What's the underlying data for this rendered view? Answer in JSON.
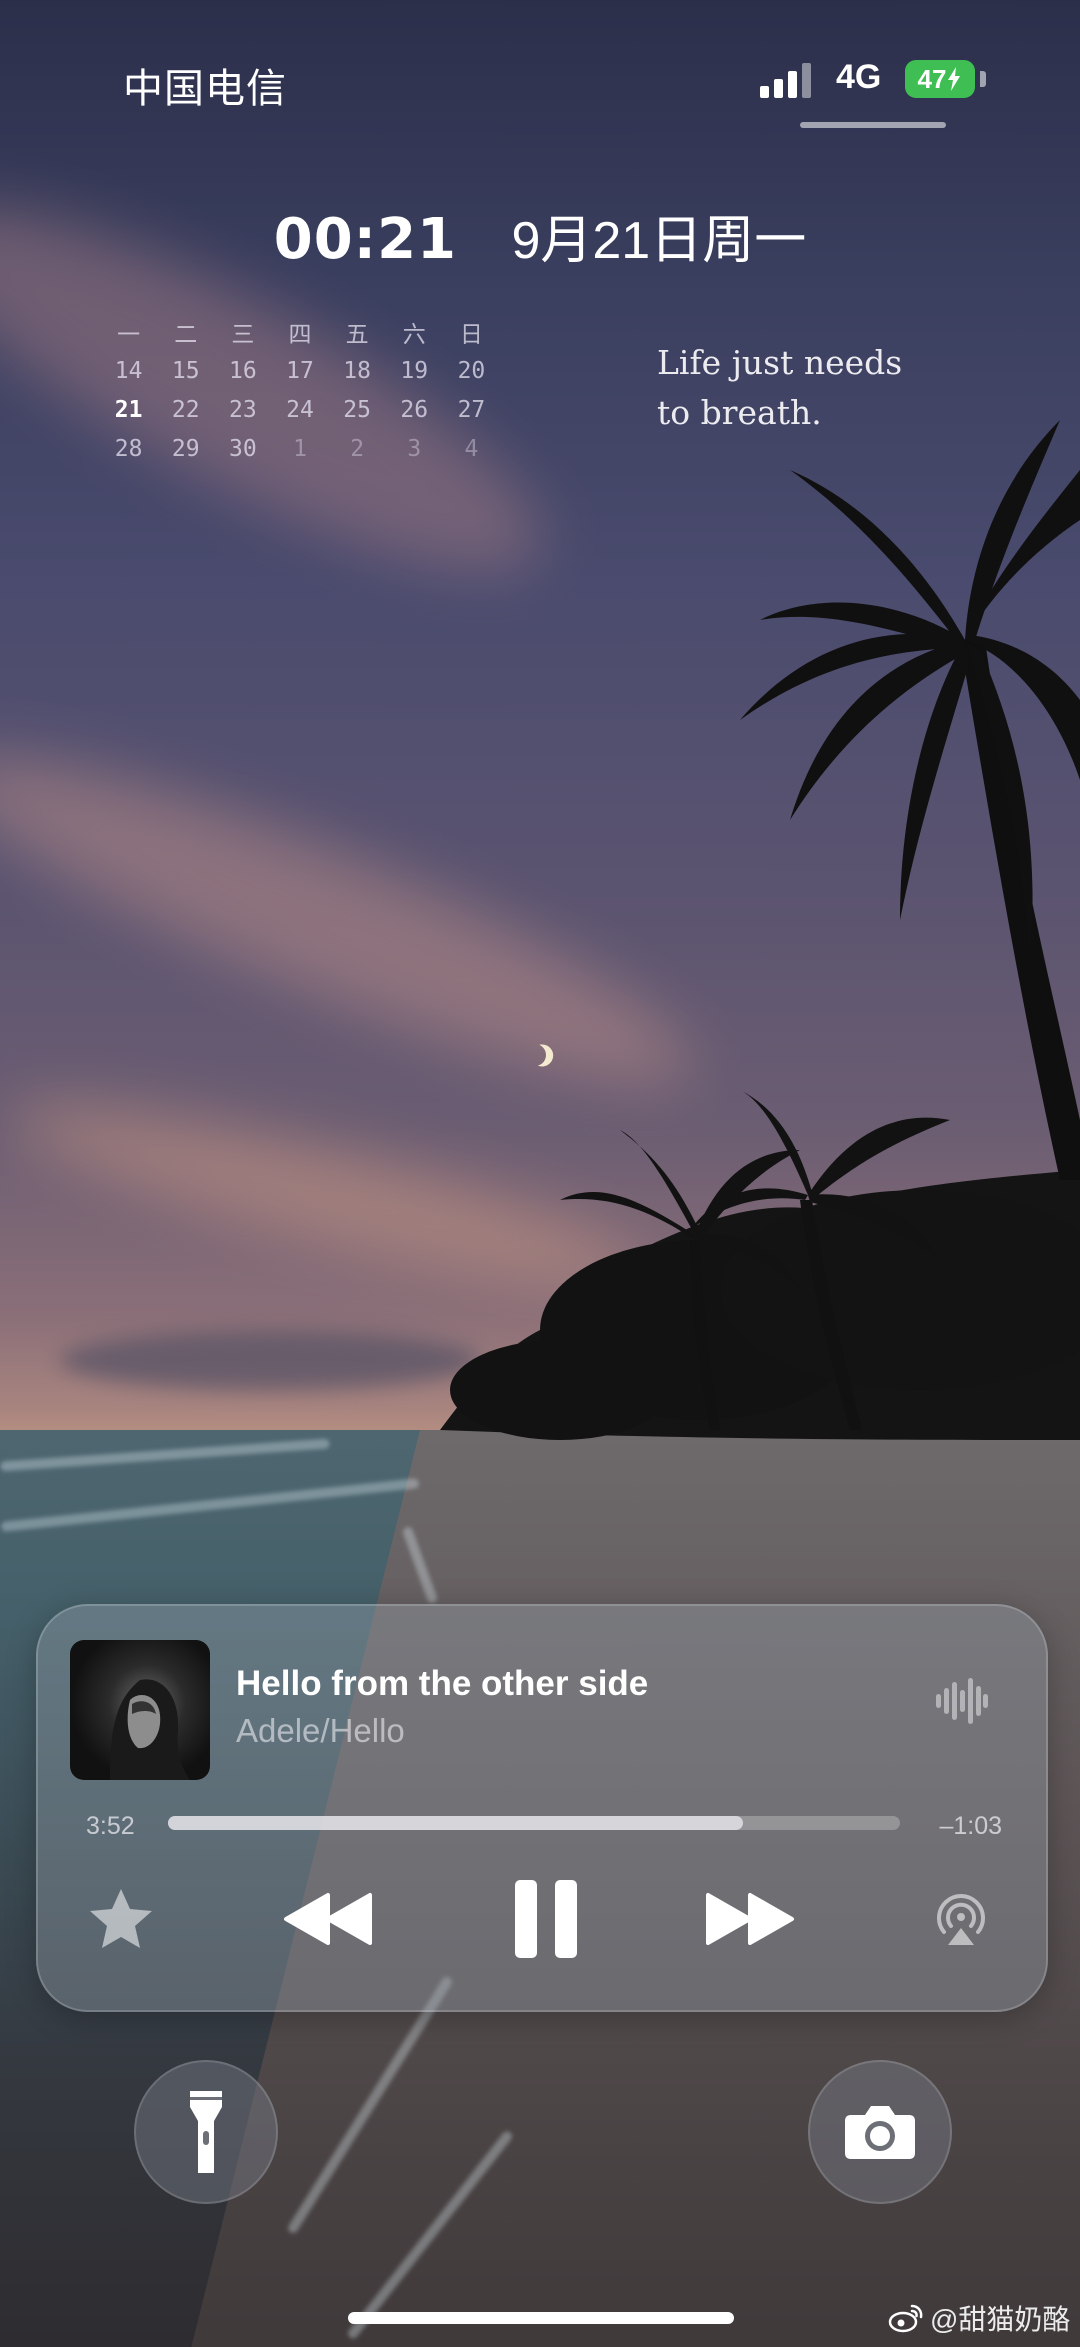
{
  "status_bar": {
    "carrier": "中国电信",
    "network": "4G",
    "battery_level": "47",
    "battery_color": "#3fbf53"
  },
  "lock_screen": {
    "time": "00:21",
    "date": "9月21日周一"
  },
  "calendar": {
    "weekdays": [
      "一",
      "二",
      "三",
      "四",
      "五",
      "六",
      "日"
    ],
    "weeks": [
      [
        "14",
        "15",
        "16",
        "17",
        "18",
        "19",
        "20"
      ],
      [
        "21",
        "22",
        "23",
        "24",
        "25",
        "26",
        "27"
      ],
      [
        "28",
        "29",
        "30",
        "1",
        "2",
        "3",
        "4"
      ]
    ]
  },
  "quote": {
    "line1": "Life just needs",
    "line2": "to breath."
  },
  "now_playing": {
    "title": "Hello from the other side",
    "artist": "Adele/Hello",
    "elapsed": "3:52",
    "remaining": "–1:03",
    "progress": 0.785
  },
  "icons": {
    "favorite": "star-icon",
    "rewind": "rewind-icon",
    "pause": "pause-icon",
    "forward": "fast-forward-icon",
    "airplay": "airplay-audio-icon",
    "waveform": "waveform-icon",
    "flashlight": "flashlight-icon",
    "camera": "camera-icon"
  },
  "watermark": {
    "text": "@甜猫奶酪"
  }
}
